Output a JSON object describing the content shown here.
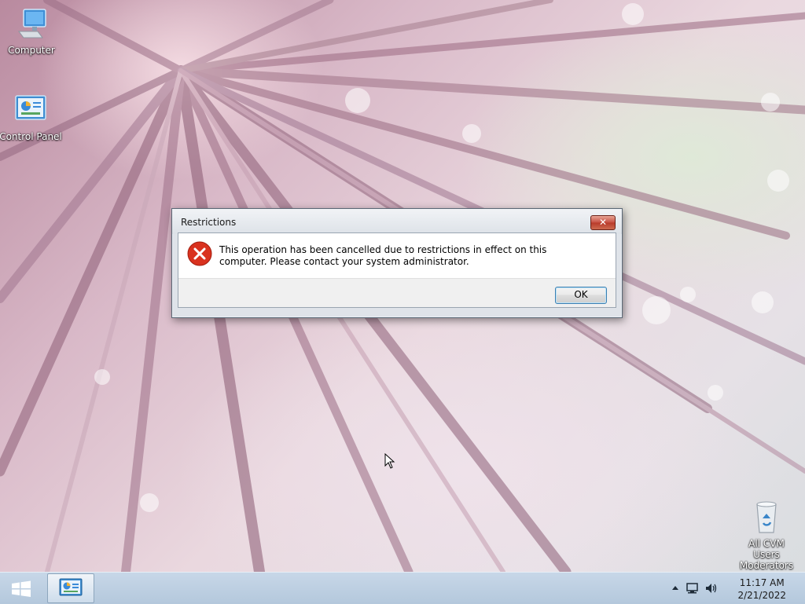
{
  "desktop": {
    "icons": [
      {
        "label": "Computer",
        "icon": "computer-icon"
      },
      {
        "label": "Control Panel",
        "icon": "control-panel-icon"
      },
      {
        "label": "All CVM Users Moderators ...",
        "icon": "recycle-bin-icon"
      }
    ]
  },
  "dialog": {
    "title": "Restrictions",
    "close_label": "✕",
    "message": "This operation has been cancelled due to restrictions in effect on this computer. Please contact your system administrator.",
    "ok_label": "OK",
    "icon": "error-icon"
  },
  "taskbar": {
    "start_icon": "windows-logo-icon",
    "pinned_item_icon": "control-panel-icon",
    "tray_icons": [
      "chevron-up-icon",
      "network-icon",
      "volume-icon"
    ],
    "time": "11:17 AM",
    "date": "2/21/2022"
  },
  "colors": {
    "error_red": "#d9321f",
    "taskbar": "#bcd0e4",
    "dialog_frame": "#dfe3e9"
  }
}
